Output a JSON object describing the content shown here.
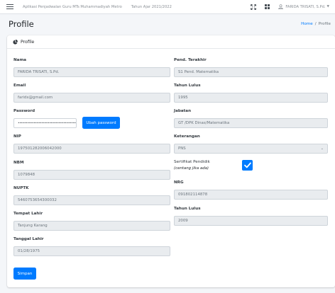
{
  "navbar": {
    "app_title": "Aplikasi Penjadwalan Guru MTs Muhammadiyah Metro",
    "school_year": "Tahun Ajar 2021/2022",
    "user_name": "FARIDA TRISATI, S.Pd."
  },
  "header": {
    "title": "Profile",
    "breadcrumb": {
      "home": "Home",
      "sep": "/",
      "current": "Profile"
    }
  },
  "card": {
    "title": "Profile"
  },
  "form": {
    "nama": {
      "label": "Nama",
      "value": "FARIDA TRISATI, S.Pd."
    },
    "email": {
      "label": "Email",
      "value": "faridx@gmail.com"
    },
    "password": {
      "label": "Password",
      "value": "••••••••••••••••••••••••••••••••••••••",
      "button": "Ubah password"
    },
    "nip": {
      "label": "NIP",
      "value": "197501282006042000"
    },
    "nbm": {
      "label": "NBM",
      "value": "1079848"
    },
    "nuptk": {
      "label": "NUPTK",
      "value": "5460753654300032"
    },
    "tempat_lahir": {
      "label": "Tempat Lahir",
      "value": "Tanjung Karang"
    },
    "tanggal_lahir": {
      "label": "Tanggal Lahir",
      "value": "01/28/1975"
    },
    "pend_terakhir": {
      "label": "Pend. Terakhir",
      "value": "S1 Pend. Matematika"
    },
    "tahun_lulus": {
      "label": "Tahun Lulus",
      "value": "1995"
    },
    "jabatan": {
      "label": "Jabatan",
      "value": "GT /DPK Dinas/Matematika"
    },
    "keterangan": {
      "label": "Keterangan",
      "value": "PNS"
    },
    "sertifikat": {
      "label": "Sertifikat Pendidik",
      "sub": "(centang jika ada)",
      "checked": true
    },
    "nrg": {
      "label": "NRG",
      "value": "091802114878"
    },
    "tahun_lulus_2": {
      "label": "Tahun Lulus",
      "value": "2009"
    },
    "submit": "Simpan"
  },
  "colors": {
    "primary": "#007bff",
    "field_bg": "#e9ecef",
    "page_bg": "#f4f6f9"
  },
  "icons": [
    "menu-icon",
    "expand-icon",
    "grid-icon",
    "user-icon",
    "chevron-down-icon",
    "pie-chart-icon",
    "check-icon"
  ]
}
